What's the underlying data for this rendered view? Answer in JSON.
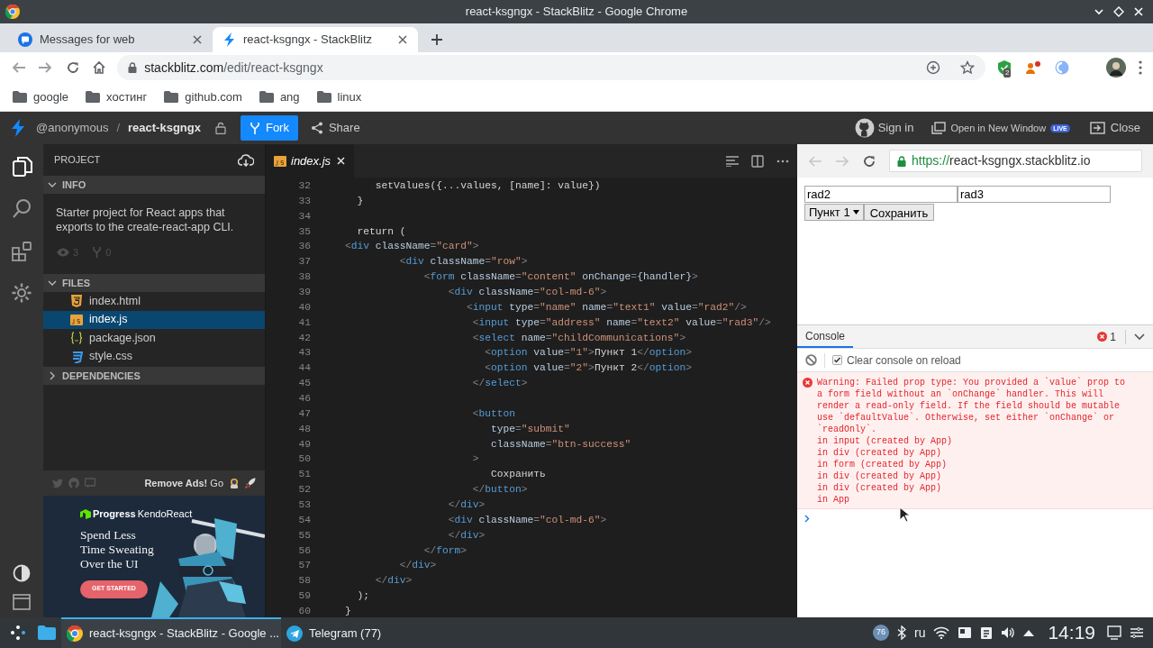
{
  "window": {
    "title": "react-ksgngx - StackBlitz - Google Chrome"
  },
  "browser_tabs": [
    {
      "label": "Messages for web",
      "kind": "messages",
      "selected": false
    },
    {
      "label": "react-ksgngx - StackBlitz",
      "kind": "stackblitz",
      "selected": true
    }
  ],
  "address_bar": {
    "host": "stackblitz.com",
    "path": "/edit/react-ksgngx"
  },
  "extension_badge": "2",
  "bookmarks": [
    "google",
    "хостинг",
    "github.com",
    "ang",
    "linux"
  ],
  "header": {
    "user": "@anonymous",
    "separator": "/",
    "project": "react-ksgngx",
    "fork": "Fork",
    "share": "Share",
    "sign_in": "Sign in",
    "open_new_window": "Open in New Window",
    "live_badge": "LIVE",
    "close": "Close"
  },
  "activity_bar": [
    {
      "kind": "files",
      "selected": true
    },
    {
      "kind": "search",
      "selected": false
    },
    {
      "kind": "extensions",
      "selected": false
    },
    {
      "kind": "settings",
      "selected": false
    }
  ],
  "sidebar": {
    "title": "PROJECT",
    "info": {
      "title": "INFO",
      "expanded": true,
      "description": "Starter project for React apps that exports to the create-react-app CLI.",
      "views": "3",
      "forks": "0"
    },
    "files": {
      "title": "FILES",
      "expanded": true,
      "items": [
        {
          "name": "index.html",
          "kind": "html",
          "selected": false
        },
        {
          "name": "index.js",
          "kind": "js",
          "selected": true
        },
        {
          "name": "package.json",
          "kind": "json",
          "selected": false
        },
        {
          "name": "style.css",
          "kind": "css",
          "selected": false
        }
      ]
    },
    "dependencies": {
      "title": "DEPENDENCIES",
      "expanded": false
    }
  },
  "promo": {
    "remove_ads": "Remove Ads!",
    "go": "Go",
    "brand": "Progress",
    "product": "KendoReact",
    "headline": [
      "Spend Less",
      "Time Sweating",
      "Over the UI"
    ],
    "cta": "GET STARTED"
  },
  "editor": {
    "tabs": [
      {
        "label": "index.js",
        "kind": "js",
        "selected": true
      }
    ],
    "lines": [
      {
        "number": "32",
        "tokens": [
          {
            "kind": "text",
            "text": "     setValues({...values, [name]: value})"
          }
        ]
      },
      {
        "number": "33",
        "tokens": [
          {
            "kind": "text",
            "text": "  }"
          }
        ]
      },
      {
        "number": "34"
      },
      {
        "number": "35",
        "tokens": [
          {
            "kind": "text",
            "text": "  return ("
          }
        ]
      },
      {
        "number": "36",
        "tokens": [
          {
            "kind": "punct",
            "text": "<"
          },
          {
            "kind": "tag",
            "text": "div"
          },
          {
            "kind": "attr",
            "text": " className"
          },
          {
            "kind": "punct",
            "text": "="
          },
          {
            "kind": "str",
            "text": "\"card\""
          },
          {
            "kind": "punct",
            "text": ">"
          }
        ]
      },
      {
        "number": "37",
        "tokens": [
          {
            "kind": "punct",
            "text": "         <"
          },
          {
            "kind": "tag",
            "text": "div"
          },
          {
            "kind": "attr",
            "text": " className"
          },
          {
            "kind": "punct",
            "text": "="
          },
          {
            "kind": "str",
            "text": "\"row\""
          },
          {
            "kind": "punct",
            "text": ">"
          }
        ]
      },
      {
        "number": "38",
        "tokens": [
          {
            "kind": "punct",
            "text": "             <"
          },
          {
            "kind": "tag",
            "text": "form"
          },
          {
            "kind": "attr",
            "text": " className"
          },
          {
            "kind": "punct",
            "text": "="
          },
          {
            "kind": "str",
            "text": "\"content\""
          },
          {
            "kind": "attr",
            "text": " onChange"
          },
          {
            "kind": "punct",
            "text": "="
          },
          {
            "kind": "attr",
            "text": "{handler}"
          },
          {
            "kind": "punct",
            "text": ">"
          }
        ]
      },
      {
        "number": "39",
        "tokens": [
          {
            "kind": "punct",
            "text": "                 <"
          },
          {
            "kind": "tag",
            "text": "div"
          },
          {
            "kind": "attr",
            "text": " className"
          },
          {
            "kind": "punct",
            "text": "="
          },
          {
            "kind": "str",
            "text": "\"col-md-6\""
          },
          {
            "kind": "punct",
            "text": ">"
          }
        ]
      },
      {
        "number": "40",
        "tokens": [
          {
            "kind": "punct",
            "text": "                    <"
          },
          {
            "kind": "tag",
            "text": "input"
          },
          {
            "kind": "attr",
            "text": " type"
          },
          {
            "kind": "punct",
            "text": "="
          },
          {
            "kind": "str",
            "text": "\"name\""
          },
          {
            "kind": "attr",
            "text": " name"
          },
          {
            "kind": "punct",
            "text": "="
          },
          {
            "kind": "str",
            "text": "\"text1\""
          },
          {
            "kind": "attr",
            "text": " value"
          },
          {
            "kind": "punct",
            "text": "="
          },
          {
            "kind": "str",
            "text": "\"rad2\""
          },
          {
            "kind": "punct",
            "text": "/>"
          }
        ]
      },
      {
        "number": "41",
        "tokens": [
          {
            "kind": "punct",
            "text": "                     <"
          },
          {
            "kind": "tag",
            "text": "input"
          },
          {
            "kind": "attr",
            "text": " type"
          },
          {
            "kind": "punct",
            "text": "="
          },
          {
            "kind": "str",
            "text": "\"address\""
          },
          {
            "kind": "attr",
            "text": " name"
          },
          {
            "kind": "punct",
            "text": "="
          },
          {
            "kind": "str",
            "text": "\"text2\""
          },
          {
            "kind": "attr",
            "text": " value"
          },
          {
            "kind": "punct",
            "text": "="
          },
          {
            "kind": "str",
            "text": "\"rad3\""
          },
          {
            "kind": "punct",
            "text": "/>"
          }
        ]
      },
      {
        "number": "42",
        "tokens": [
          {
            "kind": "punct",
            "text": "                     <"
          },
          {
            "kind": "tag",
            "text": "select"
          },
          {
            "kind": "attr",
            "text": " name"
          },
          {
            "kind": "punct",
            "text": "="
          },
          {
            "kind": "str",
            "text": "\"childCommunications\""
          },
          {
            "kind": "punct",
            "text": ">"
          }
        ]
      },
      {
        "number": "43",
        "tokens": [
          {
            "kind": "punct",
            "text": "                       <"
          },
          {
            "kind": "tag",
            "text": "option"
          },
          {
            "kind": "attr",
            "text": " value"
          },
          {
            "kind": "punct",
            "text": "="
          },
          {
            "kind": "str",
            "text": "\"1\""
          },
          {
            "kind": "punct",
            "text": ">"
          },
          {
            "kind": "text",
            "text": "Пункт 1"
          },
          {
            "kind": "punct",
            "text": "</"
          },
          {
            "kind": "tag",
            "text": "option"
          },
          {
            "kind": "punct",
            "text": ">"
          }
        ]
      },
      {
        "number": "44",
        "tokens": [
          {
            "kind": "punct",
            "text": "                       <"
          },
          {
            "kind": "tag",
            "text": "option"
          },
          {
            "kind": "attr",
            "text": " value"
          },
          {
            "kind": "punct",
            "text": "="
          },
          {
            "kind": "str",
            "text": "\"2\""
          },
          {
            "kind": "punct",
            "text": ">"
          },
          {
            "kind": "text",
            "text": "Пункт 2"
          },
          {
            "kind": "punct",
            "text": "</"
          },
          {
            "kind": "tag",
            "text": "option"
          },
          {
            "kind": "punct",
            "text": ">"
          }
        ]
      },
      {
        "number": "45",
        "tokens": [
          {
            "kind": "punct",
            "text": "                     </"
          },
          {
            "kind": "tag",
            "text": "select"
          },
          {
            "kind": "punct",
            "text": ">"
          }
        ]
      },
      {
        "number": "46"
      },
      {
        "number": "47",
        "tokens": [
          {
            "kind": "punct",
            "text": "                     <"
          },
          {
            "kind": "tag",
            "text": "button"
          }
        ]
      },
      {
        "number": "48",
        "tokens": [
          {
            "kind": "attr",
            "text": "                        type"
          },
          {
            "kind": "punct",
            "text": "="
          },
          {
            "kind": "str",
            "text": "\"submit\""
          }
        ]
      },
      {
        "number": "49",
        "tokens": [
          {
            "kind": "attr",
            "text": "                        className"
          },
          {
            "kind": "punct",
            "text": "="
          },
          {
            "kind": "str",
            "text": "\"btn-success\""
          }
        ]
      },
      {
        "number": "50",
        "tokens": [
          {
            "kind": "punct",
            "text": "                     >"
          }
        ]
      },
      {
        "number": "51",
        "tokens": [
          {
            "kind": "text",
            "text": "                        Сохранить"
          }
        ]
      },
      {
        "number": "52",
        "tokens": [
          {
            "kind": "punct",
            "text": "                     </"
          },
          {
            "kind": "tag",
            "text": "button"
          },
          {
            "kind": "punct",
            "text": ">"
          }
        ]
      },
      {
        "number": "53",
        "tokens": [
          {
            "kind": "punct",
            "text": "                 </"
          },
          {
            "kind": "tag",
            "text": "div"
          },
          {
            "kind": "punct",
            "text": ">"
          }
        ]
      },
      {
        "number": "54",
        "tokens": [
          {
            "kind": "punct",
            "text": "                 <"
          },
          {
            "kind": "tag",
            "text": "div"
          },
          {
            "kind": "attr",
            "text": " className"
          },
          {
            "kind": "punct",
            "text": "="
          },
          {
            "kind": "str",
            "text": "\"col-md-6\""
          },
          {
            "kind": "punct",
            "text": ">"
          }
        ]
      },
      {
        "number": "55",
        "tokens": [
          {
            "kind": "punct",
            "text": "                 </"
          },
          {
            "kind": "tag",
            "text": "div"
          },
          {
            "kind": "punct",
            "text": ">"
          }
        ]
      },
      {
        "number": "56",
        "tokens": [
          {
            "kind": "punct",
            "text": "             </"
          },
          {
            "kind": "tag",
            "text": "form"
          },
          {
            "kind": "punct",
            "text": ">"
          }
        ]
      },
      {
        "number": "57",
        "tokens": [
          {
            "kind": "punct",
            "text": "         </"
          },
          {
            "kind": "tag",
            "text": "div"
          },
          {
            "kind": "punct",
            "text": ">"
          }
        ]
      },
      {
        "number": "58",
        "tokens": [
          {
            "kind": "punct",
            "text": "     </"
          },
          {
            "kind": "tag",
            "text": "div"
          },
          {
            "kind": "punct",
            "text": ">"
          }
        ]
      },
      {
        "number": "59",
        "tokens": [
          {
            "kind": "text",
            "text": "  );"
          }
        ]
      },
      {
        "number": "60",
        "tokens": [
          {
            "kind": "text",
            "text": "}"
          }
        ]
      }
    ]
  },
  "preview": {
    "url_scheme": "https://",
    "url_host": "react-ksgngx.stackblitz.io",
    "inputs": [
      "rad2",
      "rad3"
    ],
    "select": "Пункт 1",
    "button": "Сохранить"
  },
  "console": {
    "tabs": [
      {
        "label": "Console",
        "selected": true
      }
    ],
    "error_count": "1",
    "clear_on_reload": {
      "label": "Clear console on reload",
      "checked": true
    },
    "messages": [
      {
        "kind": "error",
        "text": "Warning: Failed prop type: You provided a `value` prop to a form field without an `onChange` handler. This will render a read-only field. If the field should be mutable use `defaultValue`. Otherwise, set either `onChange` or `readOnly`.",
        "stack": [
          "in input (created by App)",
          "in div (created by App)",
          "in form (created by App)",
          "in div (created by App)",
          "in div (created by App)",
          "in App"
        ]
      }
    ]
  },
  "taskbar": {
    "tasks": [
      {
        "label": "react-ksgngx - StackBlitz - Google ...",
        "kind": "chrome",
        "selected": true
      },
      {
        "label": "Telegram (77)",
        "kind": "telegram",
        "selected": false
      }
    ],
    "tray_badge": "76",
    "keyboard_layout": "ru",
    "clock": "14:19"
  }
}
